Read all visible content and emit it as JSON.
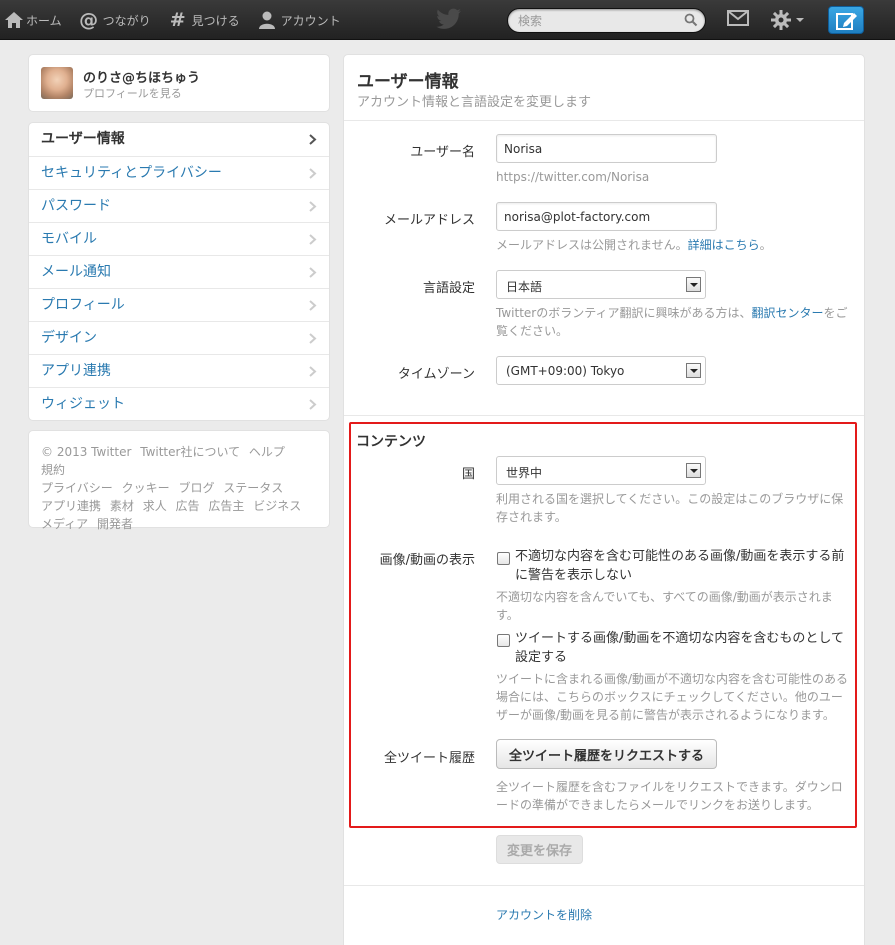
{
  "topbar": {
    "nav": [
      {
        "label": "ホーム",
        "icon": "home-icon"
      },
      {
        "label": "つながり",
        "icon": "at-icon"
      },
      {
        "label": "見つける",
        "icon": "hash-icon"
      },
      {
        "label": "アカウント",
        "icon": "user-icon"
      }
    ],
    "search_placeholder": "検索",
    "colors": {
      "bar": "#222222",
      "compose": "#2a8fd6"
    }
  },
  "profile": {
    "name": "のりさ@ちほちゅう",
    "link": "プロフィールを見る"
  },
  "menu": [
    {
      "label": "ユーザー情報",
      "active": true
    },
    {
      "label": "セキュリティとプライバシー"
    },
    {
      "label": "パスワード"
    },
    {
      "label": "モバイル"
    },
    {
      "label": "メール通知"
    },
    {
      "label": "プロフィール"
    },
    {
      "label": "デザイン"
    },
    {
      "label": "アプリ連携"
    },
    {
      "label": "ウィジェット"
    }
  ],
  "footer": {
    "links": [
      "© 2013 Twitter",
      "Twitter社について",
      "ヘルプ",
      "規約",
      "プライバシー",
      "クッキー",
      "ブログ",
      "ステータス",
      "アプリ連携",
      "素材",
      "求人",
      "広告",
      "広告主",
      "ビジネス",
      "メディア",
      "開発者"
    ]
  },
  "main": {
    "title": "ユーザー情報",
    "subtitle": "アカウント情報と言語設定を変更します",
    "username": {
      "label": "ユーザー名",
      "value": "Norisa",
      "help": "https://twitter.com/Norisa"
    },
    "email": {
      "label": "メールアドレス",
      "value": "norisa@plot-factory.com",
      "help": "メールアドレスは公開されません。",
      "help_link": "詳細はこちら",
      "help_end": "。"
    },
    "language": {
      "label": "言語設定",
      "value": "日本語",
      "help_pre": "Twitterのボランティア翻訳に興味がある方は、",
      "help_link": "翻訳センター",
      "help_post": "をご覧ください。"
    },
    "timezone": {
      "label": "タイムゾーン",
      "value": "(GMT+09:00) Tokyo"
    },
    "content": {
      "title": "コンテンツ",
      "country": {
        "label": "国",
        "value": "世界中",
        "help": "利用される国を選択してください。この設定はこのブラウザに保存されます。"
      },
      "media": {
        "label": "画像/動画の表示",
        "opt1": "不適切な内容を含む可能性のある画像/動画を表示する前に警告を表示しない",
        "opt1_help": "不適切な内容を含んでいても、すべての画像/動画が表示されます。",
        "opt2": "ツイートする画像/動画を不適切な内容を含むものとして設定する",
        "opt2_help": "ツイートに含まれる画像/動画が不適切な内容を含む可能性のある場合には、こちらのボックスにチェックしてください。他のユーザーが画像/動画を見る前に警告が表示されるようになります。"
      },
      "archive": {
        "label": "全ツイート履歴",
        "button": "全ツイート履歴をリクエストする",
        "help": "全ツイート履歴を含むファイルをリクエストできます。ダウンロードの準備ができましたらメールでリンクをお送りします。"
      }
    },
    "save": "変更を保存",
    "delete": "アカウントを削除"
  }
}
